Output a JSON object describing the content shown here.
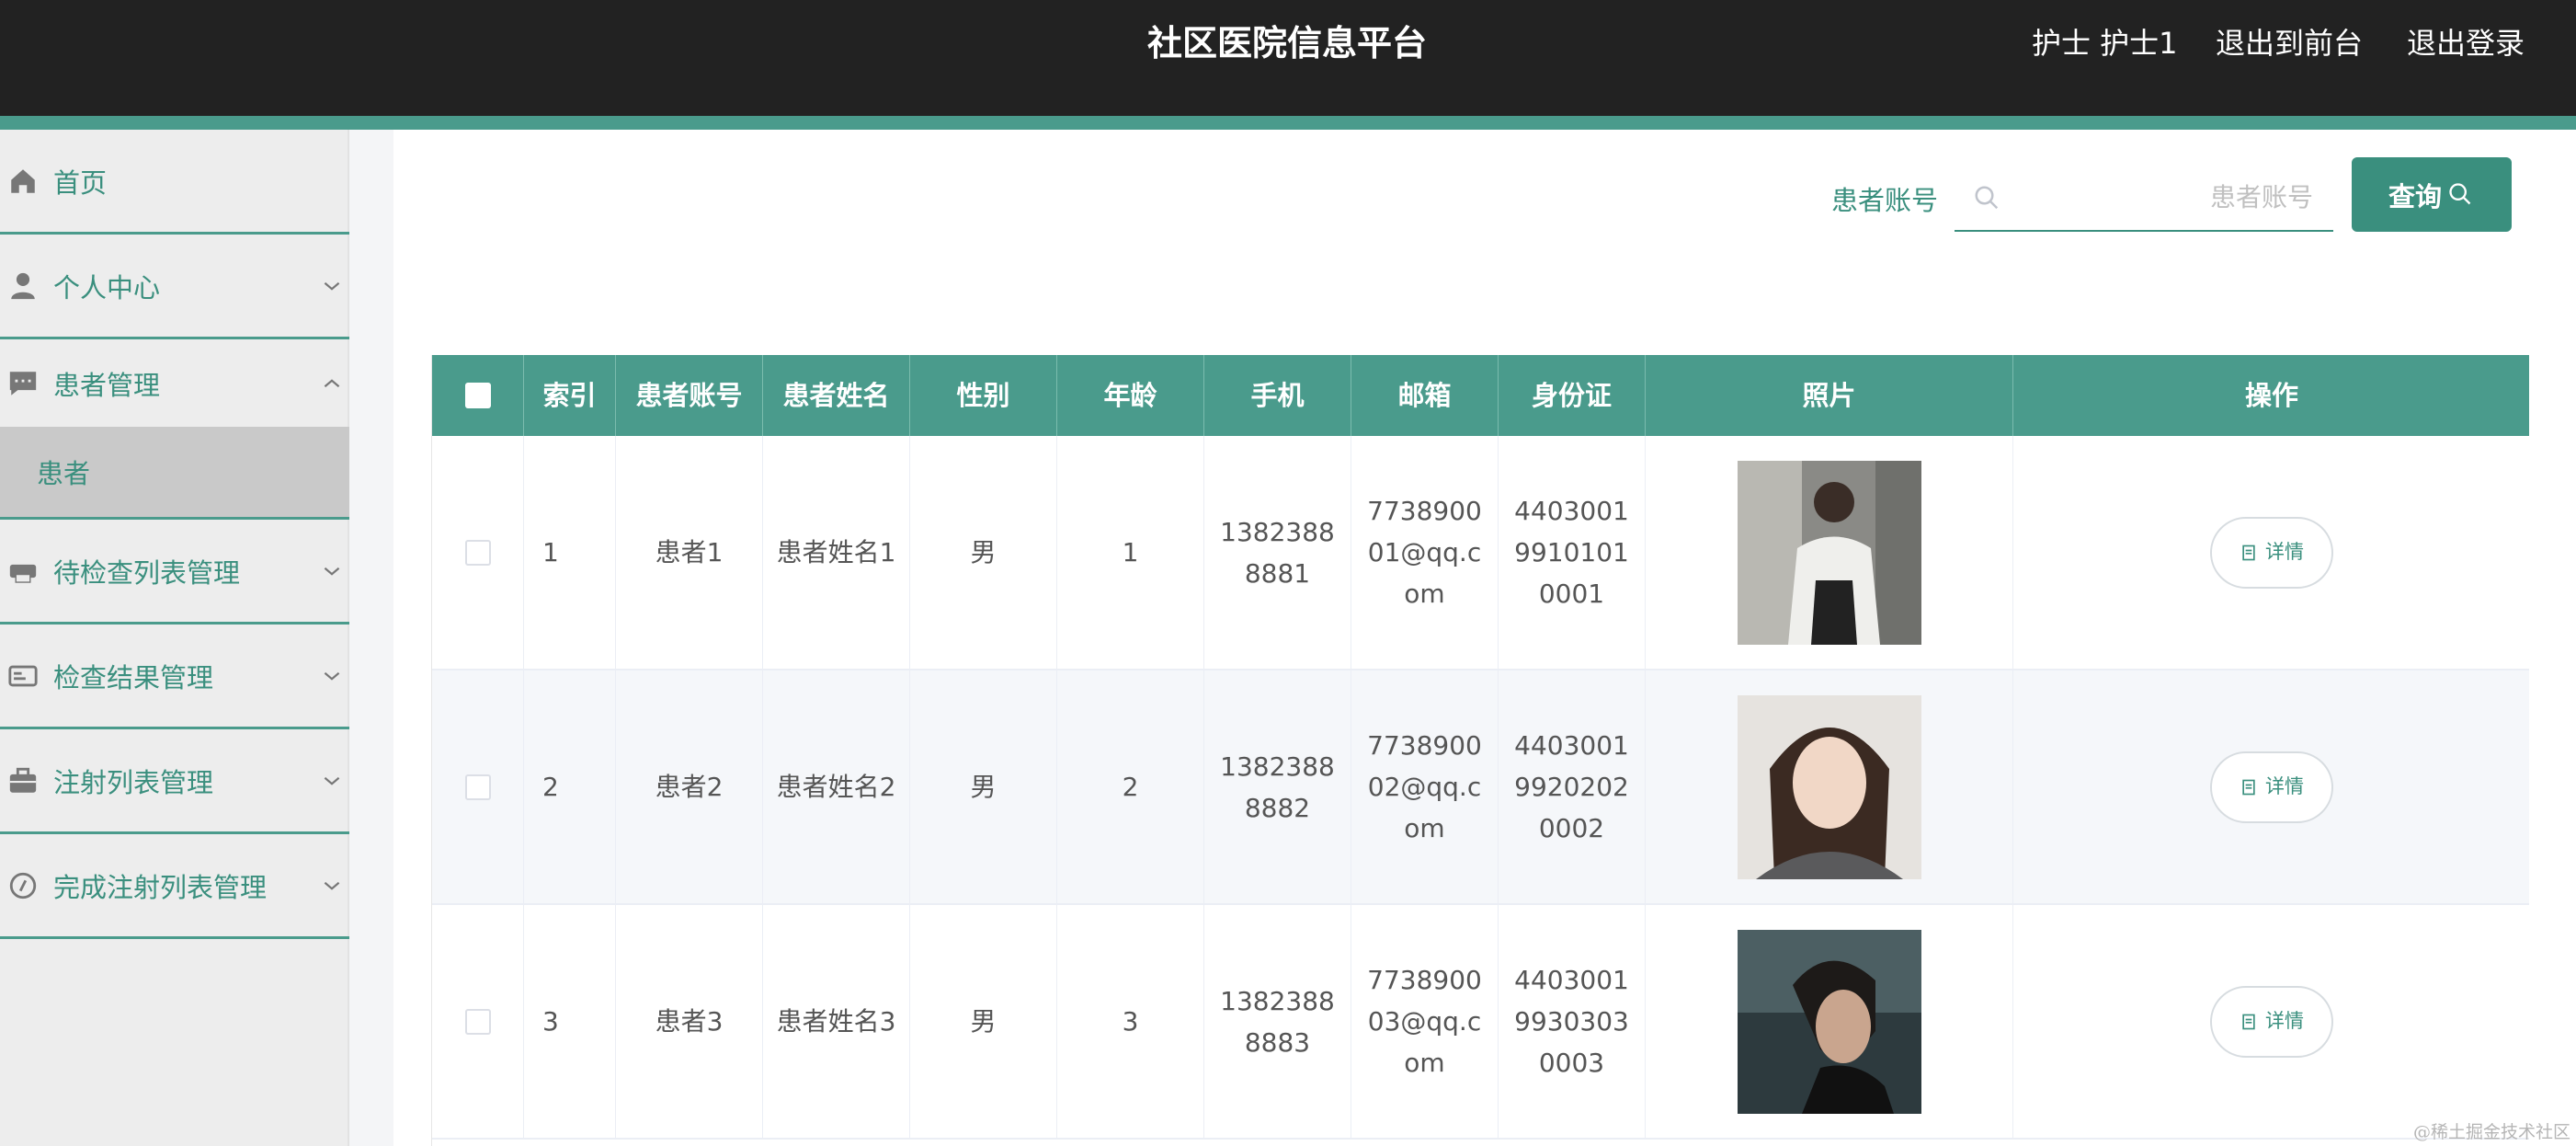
{
  "header": {
    "title": "社区医院信息平台",
    "user": "护士 护士1",
    "back_to_front": "退出到前台",
    "logout": "退出登录"
  },
  "sidebar": {
    "items": [
      {
        "label": "首页",
        "icon": "home-icon"
      },
      {
        "label": "个人中心",
        "icon": "user-icon"
      },
      {
        "label": "患者管理",
        "icon": "chat-icon",
        "expanded": true
      },
      {
        "label": "待检查列表管理",
        "icon": "printer-icon"
      },
      {
        "label": "检查结果管理",
        "icon": "id-card-icon"
      },
      {
        "label": "注射列表管理",
        "icon": "briefcase-icon"
      },
      {
        "label": "完成注射列表管理",
        "icon": "compass-icon"
      }
    ],
    "active_sub": "患者"
  },
  "search": {
    "label": "患者账号",
    "placeholder": "患者账号",
    "value": "",
    "button": "查询"
  },
  "table": {
    "columns": [
      "索引",
      "患者账号",
      "患者姓名",
      "性别",
      "年龄",
      "手机",
      "邮箱",
      "身份证",
      "照片",
      "操作"
    ],
    "rows": [
      {
        "index": "1",
        "account": "患者1",
        "name": "患者姓名1",
        "gender": "男",
        "age": "1",
        "phone": "13823888881",
        "email": "773890001@qq.com",
        "id_card": "440300199101010001",
        "action": "详情"
      },
      {
        "index": "2",
        "account": "患者2",
        "name": "患者姓名2",
        "gender": "男",
        "age": "2",
        "phone": "13823888882",
        "email": "773890002@qq.com",
        "id_card": "440300199202020002",
        "action": "详情"
      },
      {
        "index": "3",
        "account": "患者3",
        "name": "患者姓名3",
        "gender": "男",
        "age": "3",
        "phone": "13823888883",
        "email": "773890003@qq.com",
        "id_card": "440300199303030003",
        "action": "详情"
      }
    ]
  },
  "watermark": "@稀土掘金技术社区",
  "colors": {
    "topbar": "#222222",
    "accent": "#4a9b8c",
    "accent_text": "#3a8f7e",
    "sidebar_bg": "#ededed",
    "sub_active_bg": "#c9c9c9"
  }
}
